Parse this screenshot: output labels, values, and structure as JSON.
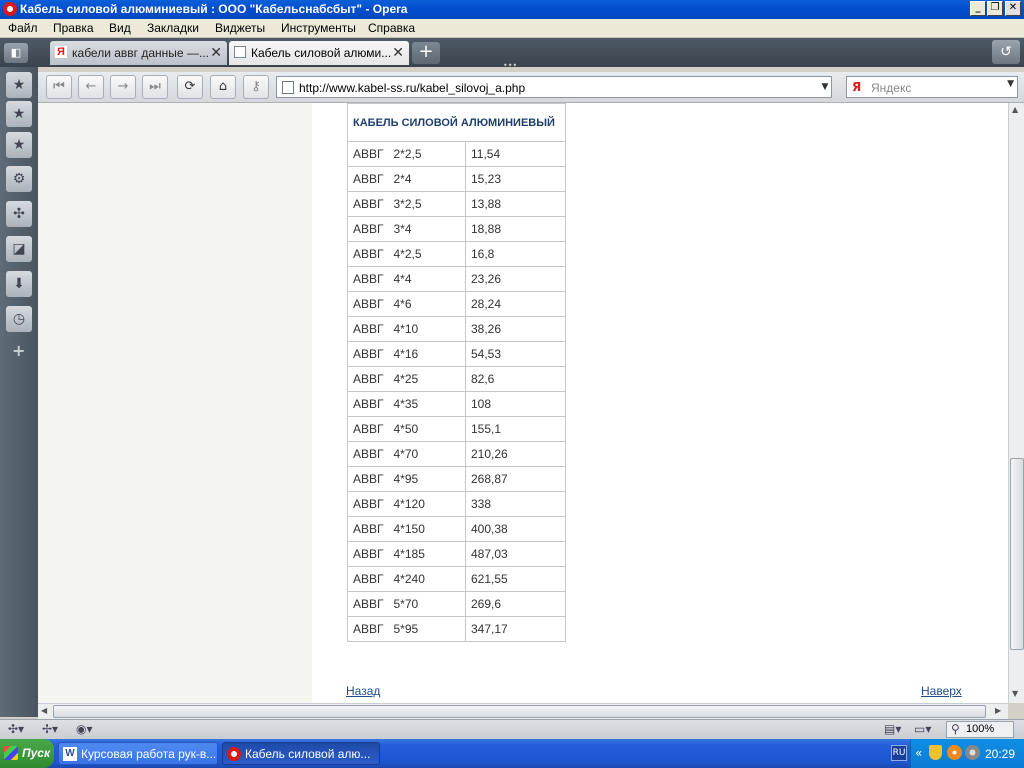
{
  "window": {
    "title": "Кабель силовой алюминиевый : ООО \"Кабельснабсбыт\" - Opera",
    "buttons": [
      "_",
      "❐",
      "✕"
    ]
  },
  "menu": [
    "Файл",
    "Правка",
    "Вид",
    "Закладки",
    "Виджеты",
    "Инструменты",
    "Справка"
  ],
  "tabs": [
    {
      "label": "кабели аввг данные —...",
      "state": "inactive",
      "favicon": "yandex-favicon"
    },
    {
      "label": "Кабель силовой алюми...",
      "state": "active",
      "favicon": "page-favicon"
    }
  ],
  "navigation": {
    "url": "http://www.kabel-ss.ru/kabel_silovoj_a.php",
    "search_placeholder": "Яндекс"
  },
  "table": {
    "heading": "КАБЕЛЬ СИЛОВОЙ АЛЮМИНИЕВЫЙ",
    "rows": [
      {
        "name": "АВВГ   2*2,5",
        "value": "11,54"
      },
      {
        "name": "АВВГ   2*4",
        "value": "15,23"
      },
      {
        "name": "АВВГ   3*2,5",
        "value": "13,88"
      },
      {
        "name": "АВВГ   3*4",
        "value": "18,88"
      },
      {
        "name": "АВВГ   4*2,5",
        "value": "16,8"
      },
      {
        "name": "АВВГ   4*4",
        "value": "23,26"
      },
      {
        "name": "АВВГ   4*6",
        "value": "28,24"
      },
      {
        "name": "АВВГ   4*10",
        "value": "38,26"
      },
      {
        "name": "АВВГ   4*16",
        "value": "54,53"
      },
      {
        "name": "АВВГ   4*25",
        "value": "82,6"
      },
      {
        "name": "АВВГ   4*35",
        "value": "108"
      },
      {
        "name": "АВВГ   4*50",
        "value": "155,1"
      },
      {
        "name": "АВВГ   4*70",
        "value": "210,26"
      },
      {
        "name": "АВВГ   4*95",
        "value": "268,87"
      },
      {
        "name": "АВВГ   4*120",
        "value": "338"
      },
      {
        "name": "АВВГ   4*150",
        "value": "400,38"
      },
      {
        "name": "АВВГ   4*185",
        "value": "487,03"
      },
      {
        "name": "АВВГ   4*240",
        "value": "621,55"
      },
      {
        "name": "АВВГ   5*70",
        "value": "269,6"
      },
      {
        "name": "АВВГ   5*95",
        "value": "347,17"
      }
    ]
  },
  "links": {
    "back": "Назад",
    "top": "Наверх"
  },
  "statusbar": {
    "zoom": "100%"
  },
  "taskbar": {
    "start": "Пуск",
    "items": [
      {
        "label": "Курсовая работа рук-в...",
        "state": "inactive"
      },
      {
        "label": "Кабель силовой алю...",
        "state": "active"
      }
    ],
    "lang": "RU",
    "tray_arrow": "«",
    "clock": "20:29"
  },
  "colors": {
    "table_heading": "#1e3f6e",
    "link": "#1d4d8a",
    "titlebar": "#0550d0",
    "taskbar": "#245edb"
  }
}
